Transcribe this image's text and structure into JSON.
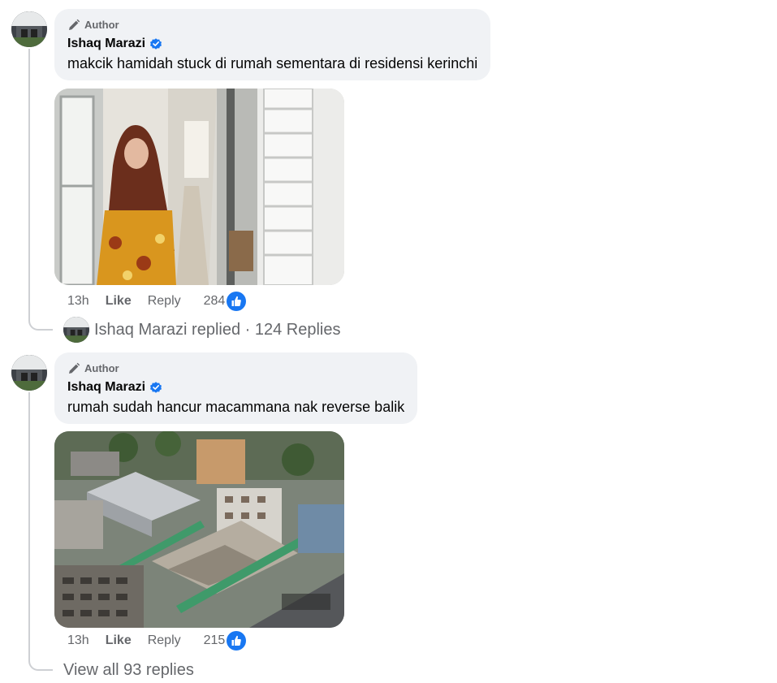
{
  "comments": [
    {
      "badge": "Author",
      "author": "Ishaq Marazi",
      "text": "makcik hamidah stuck di rumah sementara di residensi kerinchi",
      "time": "13h",
      "like_label": "Like",
      "reply_label": "Reply",
      "reactions": "284",
      "replies_summary": "Ishaq Marazi replied · 124 Replies"
    },
    {
      "badge": "Author",
      "author": "Ishaq Marazi",
      "text": "rumah sudah hancur macammana nak reverse balik",
      "time": "13h",
      "like_label": "Like",
      "reply_label": "Reply",
      "reactions": "215",
      "replies_summary": "View all 93 replies"
    }
  ],
  "icons": {
    "badge": "pencil-icon",
    "verified": "verified-badge-icon",
    "reaction": "thumbs-up-icon"
  },
  "colors": {
    "bubble": "#f0f2f5",
    "secondary_text": "#65676b",
    "like_blue": "#1877f2"
  }
}
